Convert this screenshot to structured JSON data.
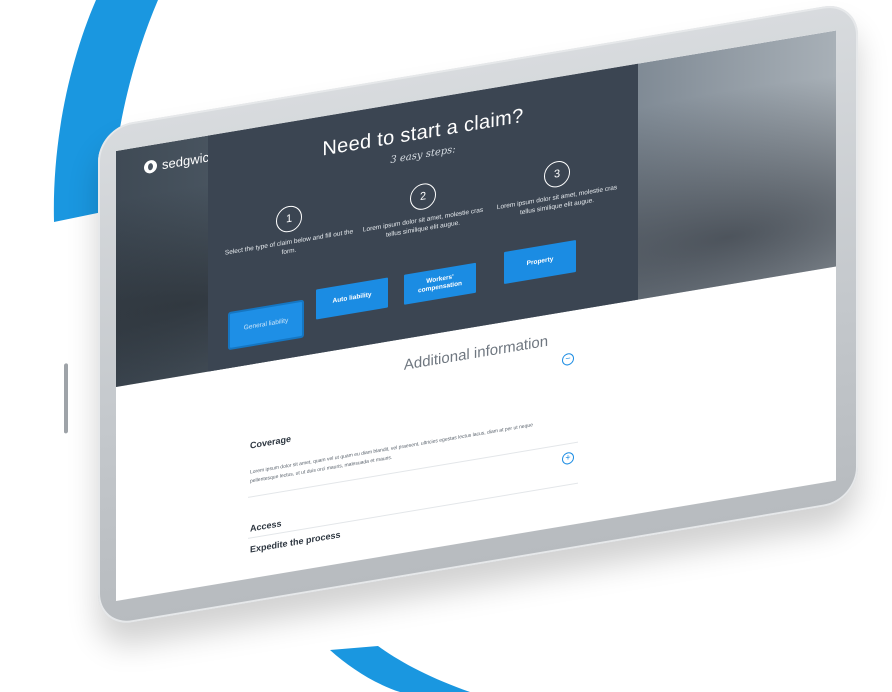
{
  "brand": {
    "name": "sedgwick"
  },
  "hero": {
    "title": "Need to start a claim?",
    "subtitle": "3 easy steps:",
    "steps": [
      {
        "number": "1",
        "text": "Select the type of claim below and fill out the form."
      },
      {
        "number": "2",
        "text": "Lorem ipsum dolor sit amet, molestie cras tellus similique elit augue."
      },
      {
        "number": "3",
        "text": "Lorem ipsum dolor sit amet, molestie cras tellus similique elit augue."
      }
    ],
    "buttons": [
      {
        "label": "General liability"
      },
      {
        "label": "Auto liability"
      },
      {
        "label": "Workers' compensation"
      },
      {
        "label": "Property"
      }
    ]
  },
  "additional_info": {
    "title": "Additional information",
    "items": [
      {
        "header": "Coverage",
        "body": "Lorem ipsum dolor sit amet, quam vel ut quam eu diam blandit, vel praesent, ultricies egestas lectus lacus, diam at per ut neque pellentesque lectus, ut ut duis orci mauris, malesuada et mauris.",
        "expanded": true,
        "toggle": "−"
      },
      {
        "header": "Access",
        "expanded": false,
        "toggle": "+"
      },
      {
        "header": "Expedite the process",
        "expanded": false,
        "toggle": ""
      }
    ]
  },
  "colors": {
    "accent": "#1b8ce3",
    "panel": "#3b4552",
    "swoosh": "#1a97e0"
  }
}
